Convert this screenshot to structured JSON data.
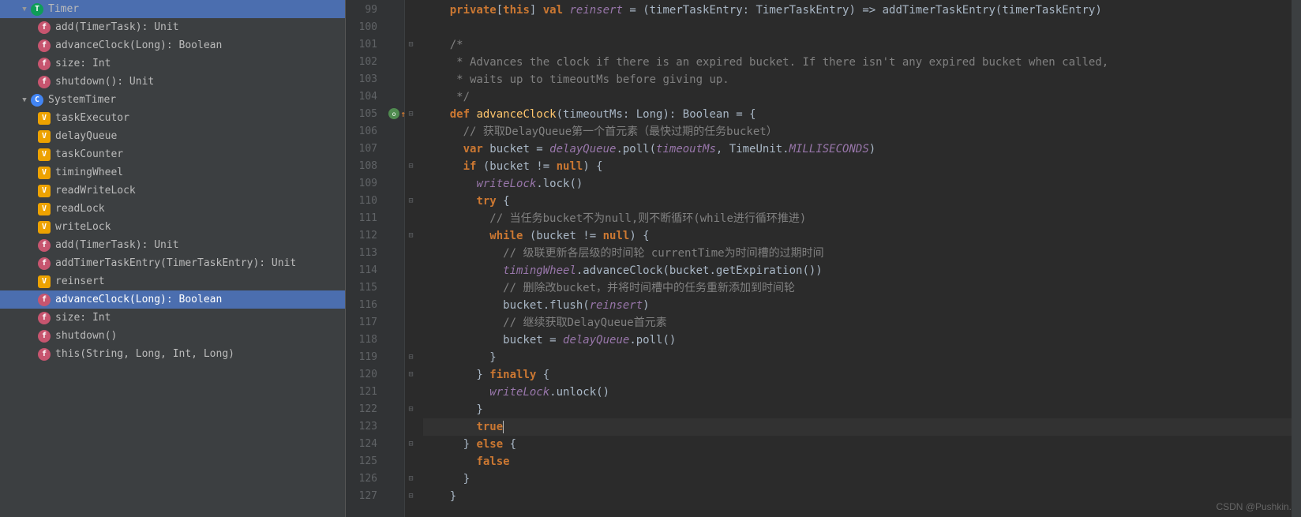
{
  "sidebar": {
    "groups": [
      {
        "name": "Timer",
        "iconType": "trait",
        "iconLetter": "T",
        "items": [
          {
            "label": "add(TimerTask): Unit",
            "iconType": "f",
            "iconLetter": "f"
          },
          {
            "label": "advanceClock(Long): Boolean",
            "iconType": "f",
            "iconLetter": "f"
          },
          {
            "label": "size: Int",
            "iconType": "f",
            "iconLetter": "f"
          },
          {
            "label": "shutdown(): Unit",
            "iconType": "f",
            "iconLetter": "f"
          }
        ]
      },
      {
        "name": "SystemTimer",
        "iconType": "class",
        "iconLetter": "C",
        "items": [
          {
            "label": "taskExecutor",
            "iconType": "v",
            "iconLetter": "V"
          },
          {
            "label": "delayQueue",
            "iconType": "v",
            "iconLetter": "V"
          },
          {
            "label": "taskCounter",
            "iconType": "v",
            "iconLetter": "V"
          },
          {
            "label": "timingWheel",
            "iconType": "v",
            "iconLetter": "V"
          },
          {
            "label": "readWriteLock",
            "iconType": "v",
            "iconLetter": "V"
          },
          {
            "label": "readLock",
            "iconType": "v",
            "iconLetter": "V"
          },
          {
            "label": "writeLock",
            "iconType": "v",
            "iconLetter": "V"
          },
          {
            "label": "add(TimerTask): Unit",
            "iconType": "f",
            "iconLetter": "f"
          },
          {
            "label": "addTimerTaskEntry(TimerTaskEntry): Unit",
            "iconType": "f",
            "iconLetter": "f"
          },
          {
            "label": "reinsert",
            "iconType": "v",
            "iconLetter": "V"
          },
          {
            "label": "advanceClock(Long): Boolean",
            "iconType": "f",
            "iconLetter": "f",
            "selected": true
          },
          {
            "label": "size: Int",
            "iconType": "f",
            "iconLetter": "f"
          },
          {
            "label": "shutdown()",
            "iconType": "f",
            "iconLetter": "f"
          },
          {
            "label": "this(String, Long, Int, Long)",
            "iconType": "f",
            "iconLetter": "f"
          }
        ]
      }
    ]
  },
  "gutter": {
    "start": 99,
    "end": 127,
    "overrideAt": 105
  },
  "code": {
    "lines": [
      {
        "n": 99,
        "tokens": [
          [
            "kw",
            "private"
          ],
          [
            "ident",
            "["
          ],
          [
            "kw",
            "this"
          ],
          [
            "ident",
            "] "
          ],
          [
            "kw",
            "val "
          ],
          [
            "italic",
            "reinsert"
          ],
          [
            "ident",
            " = (timerTaskEntry: TimerTaskEntry) => addTimerTaskEntry(timerTaskEntry)"
          ]
        ]
      },
      {
        "n": 100,
        "tokens": []
      },
      {
        "n": 101,
        "fold": "⊟",
        "tokens": [
          [
            "comment",
            "/*"
          ]
        ]
      },
      {
        "n": 102,
        "tokens": [
          [
            "comment",
            " * Advances the clock if there is an expired bucket. If there isn't any expired bucket when called,"
          ]
        ]
      },
      {
        "n": 103,
        "tokens": [
          [
            "comment",
            " * waits up to timeoutMs before giving up."
          ]
        ]
      },
      {
        "n": 104,
        "tokens": [
          [
            "comment",
            " */"
          ]
        ]
      },
      {
        "n": 105,
        "fold": "⊟",
        "override": true,
        "tokens": [
          [
            "kw",
            "def "
          ],
          [
            "method",
            "advanceClock"
          ],
          [
            "ident",
            "(timeoutMs: "
          ],
          [
            "type",
            "Long"
          ],
          [
            "ident",
            "): "
          ],
          [
            "type",
            "Boolean"
          ],
          [
            "ident",
            " = {"
          ]
        ]
      },
      {
        "n": 106,
        "tokens": [
          [
            "ident",
            "  "
          ],
          [
            "comment",
            "// 获取DelayQueue第一个首元素（最快过期的任务bucket）"
          ]
        ]
      },
      {
        "n": 107,
        "tokens": [
          [
            "ident",
            "  "
          ],
          [
            "kw",
            "var "
          ],
          [
            "ident",
            "bucket = "
          ],
          [
            "italic",
            "delayQueue"
          ],
          [
            "ident",
            ".poll("
          ],
          [
            "italic",
            "timeoutMs"
          ],
          [
            "ident",
            ", TimeUnit."
          ],
          [
            "italic",
            "MILLISECONDS"
          ],
          [
            "ident",
            ")"
          ]
        ]
      },
      {
        "n": 108,
        "fold": "⊟",
        "tokens": [
          [
            "ident",
            "  "
          ],
          [
            "kw",
            "if "
          ],
          [
            "ident",
            "(bucket != "
          ],
          [
            "kw",
            "null"
          ],
          [
            "ident",
            ") {"
          ]
        ]
      },
      {
        "n": 109,
        "tokens": [
          [
            "ident",
            "    "
          ],
          [
            "italic",
            "writeLock"
          ],
          [
            "ident",
            ".lock()"
          ]
        ]
      },
      {
        "n": 110,
        "fold": "⊟",
        "tokens": [
          [
            "ident",
            "    "
          ],
          [
            "kw",
            "try "
          ],
          [
            "ident",
            "{"
          ]
        ]
      },
      {
        "n": 111,
        "tokens": [
          [
            "ident",
            "      "
          ],
          [
            "comment",
            "// 当任务bucket不为null,则不断循环(while进行循环推进)"
          ]
        ]
      },
      {
        "n": 112,
        "fold": "⊟",
        "tokens": [
          [
            "ident",
            "      "
          ],
          [
            "kw",
            "while "
          ],
          [
            "ident",
            "(bucket != "
          ],
          [
            "kw",
            "null"
          ],
          [
            "ident",
            ") {"
          ]
        ]
      },
      {
        "n": 113,
        "tokens": [
          [
            "ident",
            "        "
          ],
          [
            "comment",
            "// 级联更新各层级的时间轮 currentTime为时间槽的过期时间"
          ]
        ]
      },
      {
        "n": 114,
        "tokens": [
          [
            "ident",
            "        "
          ],
          [
            "italic",
            "timingWheel"
          ],
          [
            "ident",
            ".advanceClock(bucket.getExpiration())"
          ]
        ]
      },
      {
        "n": 115,
        "tokens": [
          [
            "ident",
            "        "
          ],
          [
            "comment",
            "// 删除改bucket，并将时间槽中的任务重新添加到时间轮"
          ]
        ]
      },
      {
        "n": 116,
        "tokens": [
          [
            "ident",
            "        bucket.flush("
          ],
          [
            "italic",
            "reinsert"
          ],
          [
            "ident",
            ")"
          ]
        ]
      },
      {
        "n": 117,
        "tokens": [
          [
            "ident",
            "        "
          ],
          [
            "comment",
            "// 继续获取DelayQueue首元素"
          ]
        ]
      },
      {
        "n": 118,
        "tokens": [
          [
            "ident",
            "        bucket = "
          ],
          [
            "italic",
            "delayQueue"
          ],
          [
            "ident",
            ".poll()"
          ]
        ]
      },
      {
        "n": 119,
        "fold": "⊟",
        "tokens": [
          [
            "ident",
            "      }"
          ]
        ]
      },
      {
        "n": 120,
        "fold": "⊟",
        "tokens": [
          [
            "ident",
            "    } "
          ],
          [
            "kw",
            "finally "
          ],
          [
            "ident",
            "{"
          ]
        ]
      },
      {
        "n": 121,
        "tokens": [
          [
            "ident",
            "      "
          ],
          [
            "italic",
            "writeLock"
          ],
          [
            "ident",
            ".unlock()"
          ]
        ]
      },
      {
        "n": 122,
        "fold": "⊟",
        "tokens": [
          [
            "ident",
            "    }"
          ]
        ]
      },
      {
        "n": 123,
        "current": true,
        "tokens": [
          [
            "ident",
            "    "
          ],
          [
            "kw",
            "true"
          ],
          [
            "caret",
            ""
          ]
        ]
      },
      {
        "n": 124,
        "fold": "⊟",
        "tokens": [
          [
            "ident",
            "  } "
          ],
          [
            "kw",
            "else "
          ],
          [
            "ident",
            "{"
          ]
        ]
      },
      {
        "n": 125,
        "tokens": [
          [
            "ident",
            "    "
          ],
          [
            "kw",
            "false"
          ]
        ]
      },
      {
        "n": 126,
        "fold": "⊟",
        "tokens": [
          [
            "ident",
            "  }"
          ]
        ]
      },
      {
        "n": 127,
        "fold": "⊟",
        "tokens": [
          [
            "ident",
            "}"
          ]
        ]
      }
    ],
    "indent": "    "
  },
  "watermark": "CSDN @Pushkin."
}
